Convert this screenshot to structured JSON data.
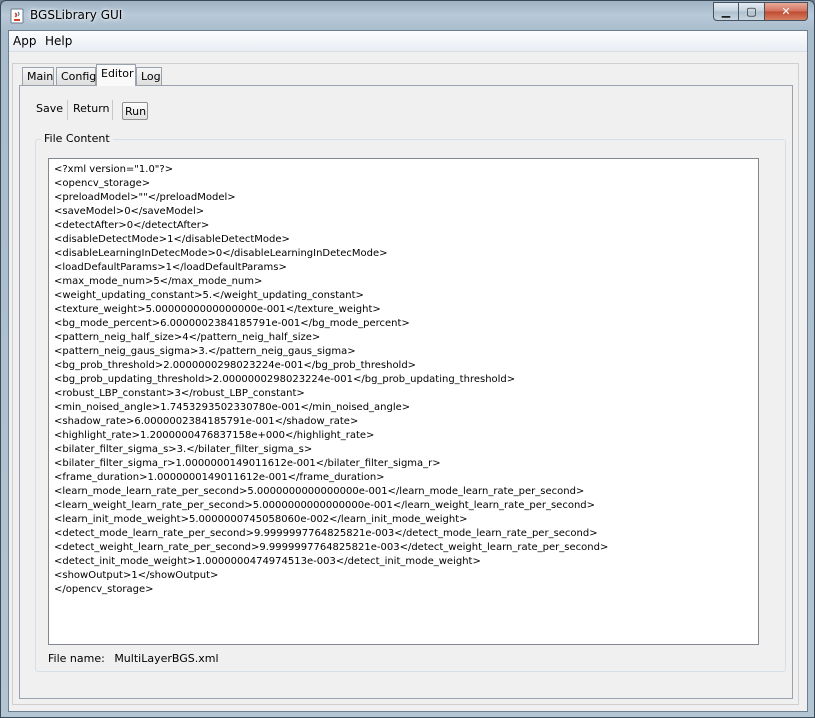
{
  "window": {
    "title": "BGSLibrary GUI",
    "controls": {
      "minimize": "▁",
      "maximize": "▢",
      "close": "✕"
    }
  },
  "menubar": {
    "items": [
      "App",
      "Help"
    ]
  },
  "tabs": [
    {
      "label": "Main",
      "active": false
    },
    {
      "label": "Config",
      "active": false
    },
    {
      "label": "Editor",
      "active": true
    },
    {
      "label": "Log",
      "active": false
    }
  ],
  "toolbar": {
    "save_label": "Save",
    "return_label": "Return",
    "run_label": "Run"
  },
  "file_content": {
    "legend": "File Content",
    "lines": [
      "<?xml version=\"1.0\"?>",
      "<opencv_storage>",
      "<preloadModel>\"\"</preloadModel>",
      "<saveModel>0</saveModel>",
      "<detectAfter>0</detectAfter>",
      "<disableDetectMode>1</disableDetectMode>",
      "<disableLearningInDetecMode>0</disableLearningInDetecMode>",
      "<loadDefaultParams>1</loadDefaultParams>",
      "<max_mode_num>5</max_mode_num>",
      "<weight_updating_constant>5.</weight_updating_constant>",
      "<texture_weight>5.0000000000000000e-001</texture_weight>",
      "<bg_mode_percent>6.0000002384185791e-001</bg_mode_percent>",
      "<pattern_neig_half_size>4</pattern_neig_half_size>",
      "<pattern_neig_gaus_sigma>3.</pattern_neig_gaus_sigma>",
      "<bg_prob_threshold>2.0000000298023224e-001</bg_prob_threshold>",
      "<bg_prob_updating_threshold>2.0000000298023224e-001</bg_prob_updating_threshold>",
      "<robust_LBP_constant>3</robust_LBP_constant>",
      "<min_noised_angle>1.7453293502330780e-001</min_noised_angle>",
      "<shadow_rate>6.0000002384185791e-001</shadow_rate>",
      "<highlight_rate>1.2000000476837158e+000</highlight_rate>",
      "<bilater_filter_sigma_s>3.</bilater_filter_sigma_s>",
      "<bilater_filter_sigma_r>1.0000000149011612e-001</bilater_filter_sigma_r>",
      "<frame_duration>1.0000000149011612e-001</frame_duration>",
      "<learn_mode_learn_rate_per_second>5.0000000000000000e-001</learn_mode_learn_rate_per_second>",
      "<learn_weight_learn_rate_per_second>5.0000000000000000e-001</learn_weight_learn_rate_per_second>",
      "<learn_init_mode_weight>5.0000000745058060e-002</learn_init_mode_weight>",
      "<detect_mode_learn_rate_per_second>9.9999997764825821e-003</detect_mode_learn_rate_per_second>",
      "<detect_weight_learn_rate_per_second>9.9999997764825821e-003</detect_weight_learn_rate_per_second>",
      "<detect_init_mode_weight>1.0000000474974513e-003</detect_init_mode_weight>",
      "<showOutput>1</showOutput>",
      "</opencv_storage>"
    ]
  },
  "file_name": {
    "label": "File name:",
    "value": "MultiLayerBGS.xml"
  }
}
